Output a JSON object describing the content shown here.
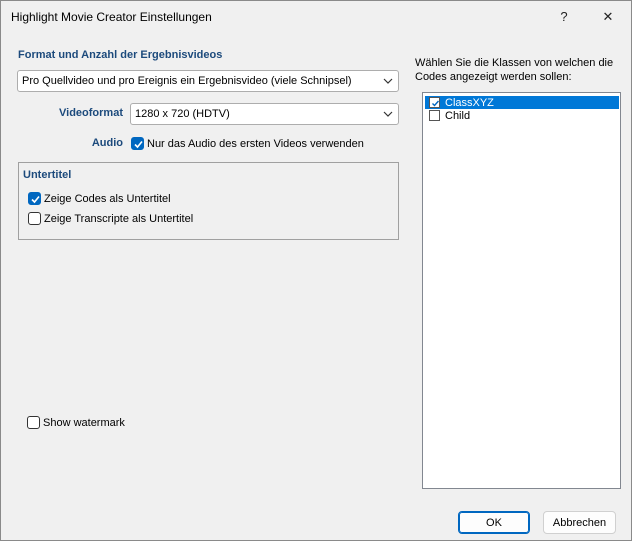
{
  "window": {
    "title": "Highlight Movie Creator Einstellungen",
    "help_glyph": "?",
    "close_glyph": "✕"
  },
  "format": {
    "heading": "Format und Anzahl der Ergebnisvideos",
    "selected": "Pro Quellvideo und pro Ereignis ein Ergebnisvideo (viele Schnipsel)"
  },
  "videoformat": {
    "label": "Videoformat",
    "selected": "1280 x 720 (HDTV)"
  },
  "audio": {
    "label": "Audio",
    "checkbox_label": "Nur das Audio des ersten Videos verwenden",
    "checked": true
  },
  "subtitles": {
    "heading": "Untertitel",
    "items": [
      {
        "label": "Zeige Codes als Untertitel",
        "checked": true
      },
      {
        "label": "Zeige Transcripte als Untertitel",
        "checked": false
      }
    ]
  },
  "watermark": {
    "label": "Show watermark",
    "checked": false
  },
  "classes": {
    "prompt": "Wählen Sie die Klassen von welchen die Codes angezeigt werden sollen:",
    "items": [
      {
        "label": "ClassXYZ",
        "checked": true,
        "selected": true
      },
      {
        "label": "Child",
        "checked": false,
        "selected": false
      }
    ]
  },
  "buttons": {
    "ok": "OK",
    "cancel": "Abbrechen"
  },
  "colors": {
    "accent": "#0067c0",
    "heading": "#1c4a7c",
    "selection": "#0078d7"
  }
}
